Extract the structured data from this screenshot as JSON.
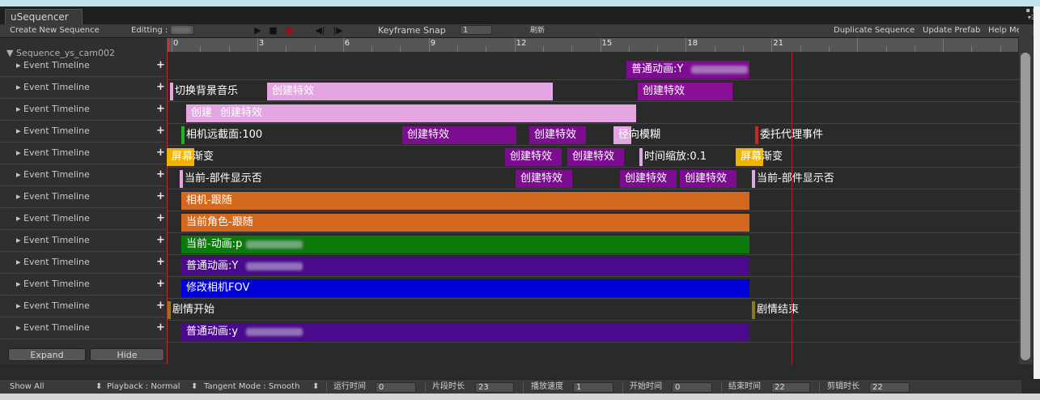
{
  "window": {
    "tab_title": "uSequencer"
  },
  "toolbar": {
    "create_new_sequence": "Create New Sequence",
    "editing_label": "Editting :",
    "keyframe_snap_label": "Keyframe Snap",
    "keyframe_snap_value": "1",
    "apply_label": "刷新",
    "duplicate_sequence": "Duplicate Sequence",
    "update_prefab": "Update Prefab",
    "help": "Help Me?!"
  },
  "ruler": {
    "ticks": [
      "0",
      "3",
      "6",
      "9",
      "12",
      "15",
      "18",
      "21"
    ]
  },
  "sequence": {
    "name": "Sequence_ys_cam002"
  },
  "timelines": [
    {
      "label": "Event Timeline",
      "events": [
        {
          "text": "普通动画:Y",
          "color": "#7c0c90",
          "blurred": true
        }
      ]
    },
    {
      "label": "Event Timeline",
      "events": [
        {
          "text": "切换背景音乐",
          "color": "#e3a6e3",
          "lbl": true,
          "marker": "#e3a6e3"
        },
        {
          "text": "创建特效",
          "color": "#e3a6e3"
        },
        {
          "text": "创建特效",
          "color": "#8a1096"
        }
      ]
    },
    {
      "label": "Event Timeline",
      "events": [
        {
          "text": "创建",
          "color": "#e3a6e3"
        },
        {
          "text": "创建特效",
          "color": "#e3a6e3"
        }
      ]
    },
    {
      "label": "Event Timeline",
      "events": [
        {
          "text": "相机远截面:100",
          "lbl": true,
          "marker": "#1fb51f"
        },
        {
          "text": "创建特效",
          "color": "#7c0c90"
        },
        {
          "text": "创建特效",
          "color": "#7c0c90"
        },
        {
          "text": "径向模糊",
          "color": "#e3a6e3",
          "lbl_after": true
        },
        {
          "text": "委托代理事件",
          "lbl": true,
          "marker": "#c62828"
        }
      ]
    },
    {
      "label": "Event Timeline",
      "events": [
        {
          "text": "屏幕渐变",
          "color": "#f0b400",
          "lbl_after": true
        },
        {
          "text": "创建特效",
          "color": "#7c0c90"
        },
        {
          "text": "创建特效",
          "color": "#7c0c90"
        },
        {
          "text": "时间缩放:0.1",
          "lbl": true,
          "marker": "#e3a6e3"
        },
        {
          "text": "屏幕渐变",
          "color": "#f0b400",
          "lbl_after": true
        }
      ]
    },
    {
      "label": "Event Timeline",
      "events": [
        {
          "text": "当前-部件显示否",
          "lbl": true,
          "marker": "#e3a6e3"
        },
        {
          "text": "创建特效",
          "color": "#7c0c90"
        },
        {
          "text": "创建特效",
          "color": "#7c0c90"
        },
        {
          "text": "创建特效",
          "color": "#7c0c90"
        },
        {
          "text": "当前-部件显示否",
          "lbl": true,
          "marker": "#e3a6e3"
        }
      ]
    },
    {
      "label": "Event Timeline",
      "events": [
        {
          "text": "相机-跟随",
          "color": "#d2691e"
        }
      ]
    },
    {
      "label": "Event Timeline",
      "events": [
        {
          "text": "当前角色-跟随",
          "color": "#d2691e"
        }
      ]
    },
    {
      "label": "Event Timeline",
      "events": [
        {
          "text": "当前-动画:p",
          "color": "#0a7a0a",
          "blurred": true
        }
      ]
    },
    {
      "label": "Event Timeline",
      "events": [
        {
          "text": "普通动画:Y",
          "color": "#4b0a8c",
          "blurred": true
        }
      ]
    },
    {
      "label": "Event Timeline",
      "events": [
        {
          "text": "修改相机FOV",
          "color": "#0000d8"
        }
      ]
    },
    {
      "label": "Event Timeline",
      "events": [
        {
          "text": "剧情开始",
          "lbl": true,
          "marker": "#8a7a1a"
        },
        {
          "text": "剧情结束",
          "lbl": true,
          "marker": "#8a7a1a"
        }
      ]
    },
    {
      "label": "Event Timeline",
      "events": [
        {
          "text": "普通动画:y",
          "color": "#4b0a8c",
          "blurred": true
        }
      ]
    }
  ],
  "buttons": {
    "expand": "Expand",
    "hide": "Hide"
  },
  "bottombar": {
    "show_all": "Show All",
    "playback": "Playback : Normal",
    "tangent": "Tangent Mode : Smooth",
    "run_time_label": "运行时间",
    "run_time_value": "0",
    "clip_length_label": "片段时长",
    "clip_length_value": "23",
    "play_speed_label": "播放速度",
    "play_speed_value": "1",
    "start_time_label": "开始时间",
    "start_time_value": "0",
    "end_time_label": "结束时间",
    "end_time_value": "22",
    "cut_length_label": "剪辑时长",
    "cut_length_value": "22"
  }
}
